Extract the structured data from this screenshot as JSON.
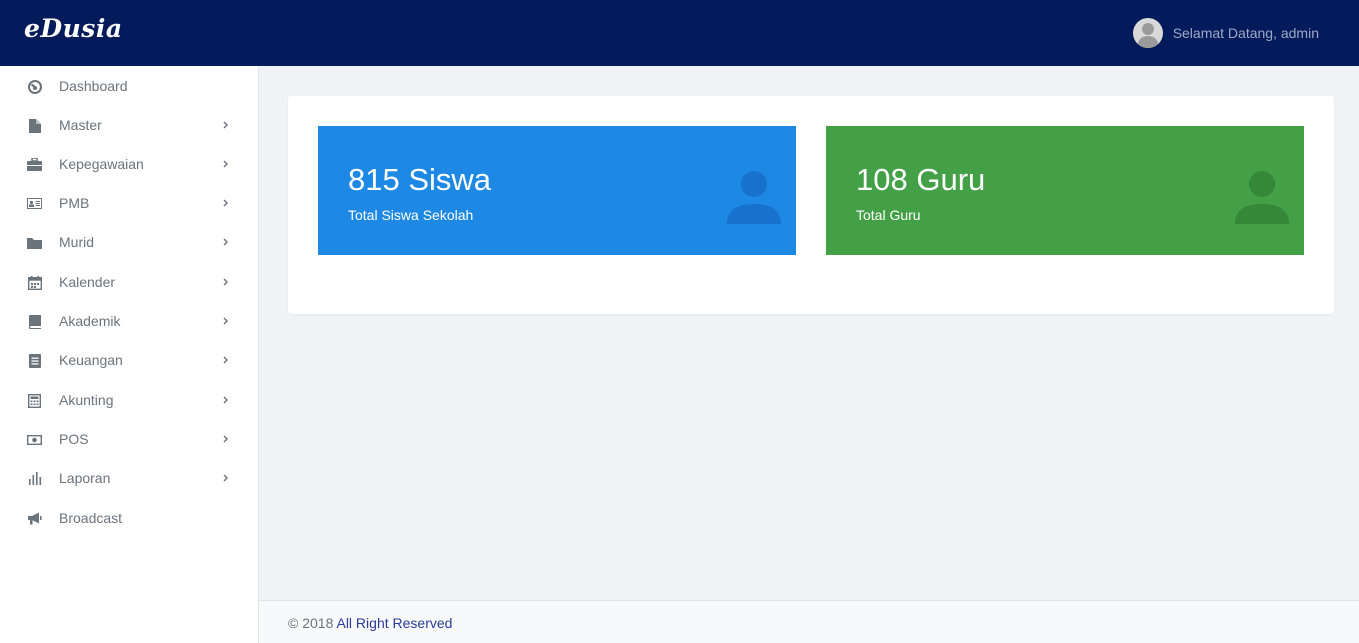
{
  "brand": {
    "logo": "eDusia"
  },
  "header": {
    "welcome": "Selamat Datang, admin",
    "avatar_icon": "user-avatar-icon"
  },
  "sidebar": {
    "items": [
      {
        "label": "Dashboard",
        "icon": "dashboard-icon",
        "has_children": false
      },
      {
        "label": "Master",
        "icon": "file-icon",
        "has_children": true
      },
      {
        "label": "Kepegawaian",
        "icon": "briefcase-icon",
        "has_children": true
      },
      {
        "label": "PMB",
        "icon": "id-card-icon",
        "has_children": true
      },
      {
        "label": "Murid",
        "icon": "folder-icon",
        "has_children": true
      },
      {
        "label": "Kalender",
        "icon": "calendar-icon",
        "has_children": true
      },
      {
        "label": "Akademik",
        "icon": "book-icon",
        "has_children": true
      },
      {
        "label": "Keuangan",
        "icon": "document-icon",
        "has_children": true
      },
      {
        "label": "Akunting",
        "icon": "calculator-icon",
        "has_children": true
      },
      {
        "label": "POS",
        "icon": "money-icon",
        "has_children": true
      },
      {
        "label": "Laporan",
        "icon": "bar-chart-icon",
        "has_children": true
      },
      {
        "label": "Broadcast",
        "icon": "megaphone-icon",
        "has_children": false
      }
    ]
  },
  "stats": {
    "students": {
      "count": "815 Siswa",
      "label": "Total Siswa Sekolah",
      "color": "#1e88e5",
      "icon": "user-icon"
    },
    "teachers": {
      "count": "108 Guru",
      "label": "Total Guru",
      "color": "#43a047",
      "icon": "user-icon"
    }
  },
  "footer": {
    "copyright": "© 2018",
    "link": "All Right Reserved"
  },
  "colors": {
    "topbar": "#031b5b",
    "link": "#2a3c9a",
    "text_muted": "#6b737b"
  }
}
